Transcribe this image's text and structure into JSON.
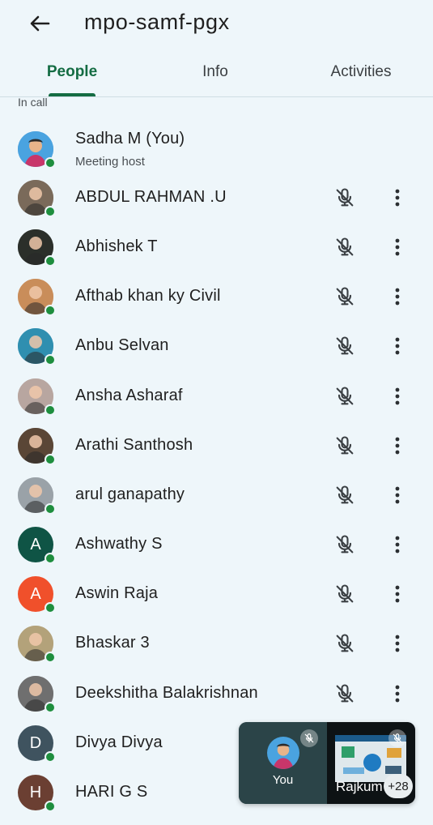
{
  "header": {
    "title": "mpo-samf-pgx",
    "back_icon": "arrow-back-icon"
  },
  "tabs": [
    {
      "label": "People",
      "active": true
    },
    {
      "label": "Info",
      "active": false
    },
    {
      "label": "Activities",
      "active": false
    }
  ],
  "section": {
    "label": "In call"
  },
  "host": {
    "name": "Sadha M (You)",
    "role": "Meeting host"
  },
  "participants": [
    {
      "name": "ABDUL RAHMAN .U",
      "avatar": "photo",
      "color": "#7a6a5a"
    },
    {
      "name": "Abhishek T",
      "avatar": "photo",
      "color": "#2b2f2a"
    },
    {
      "name": "Afthab khan ky Civil",
      "avatar": "photo",
      "color": "#c98d5a"
    },
    {
      "name": "Anbu Selvan",
      "avatar": "photo",
      "color": "#2f8fb0"
    },
    {
      "name": "Ansha Asharaf",
      "avatar": "photo",
      "color": "#b8a6a0"
    },
    {
      "name": "Arathi Santhosh",
      "avatar": "photo",
      "color": "#5a4636"
    },
    {
      "name": "arul ganapathy",
      "avatar": "photo",
      "color": "#9aa2a8"
    },
    {
      "name": "Ashwathy S",
      "avatar": "letter",
      "letter": "A",
      "color": "#0f5445"
    },
    {
      "name": "Aswin Raja",
      "avatar": "letter",
      "letter": "A",
      "color": "#f0502b"
    },
    {
      "name": "Bhaskar 3",
      "avatar": "photo",
      "color": "#b3a27a"
    },
    {
      "name": "Deekshitha Balakrishnan",
      "avatar": "photo",
      "color": "#6f6f6f"
    },
    {
      "name": "Divya Divya",
      "avatar": "letter",
      "letter": "D",
      "color": "#3f535f"
    },
    {
      "name": "HARI G S",
      "avatar": "letter",
      "letter": "H",
      "color": "#6b3f32"
    }
  ],
  "pip": {
    "self_label": "You",
    "other_label": "Rajkum",
    "count": "+28"
  },
  "colors": {
    "accent": "#146c43",
    "online": "#1e8e3e",
    "background": "#eef6fa"
  }
}
